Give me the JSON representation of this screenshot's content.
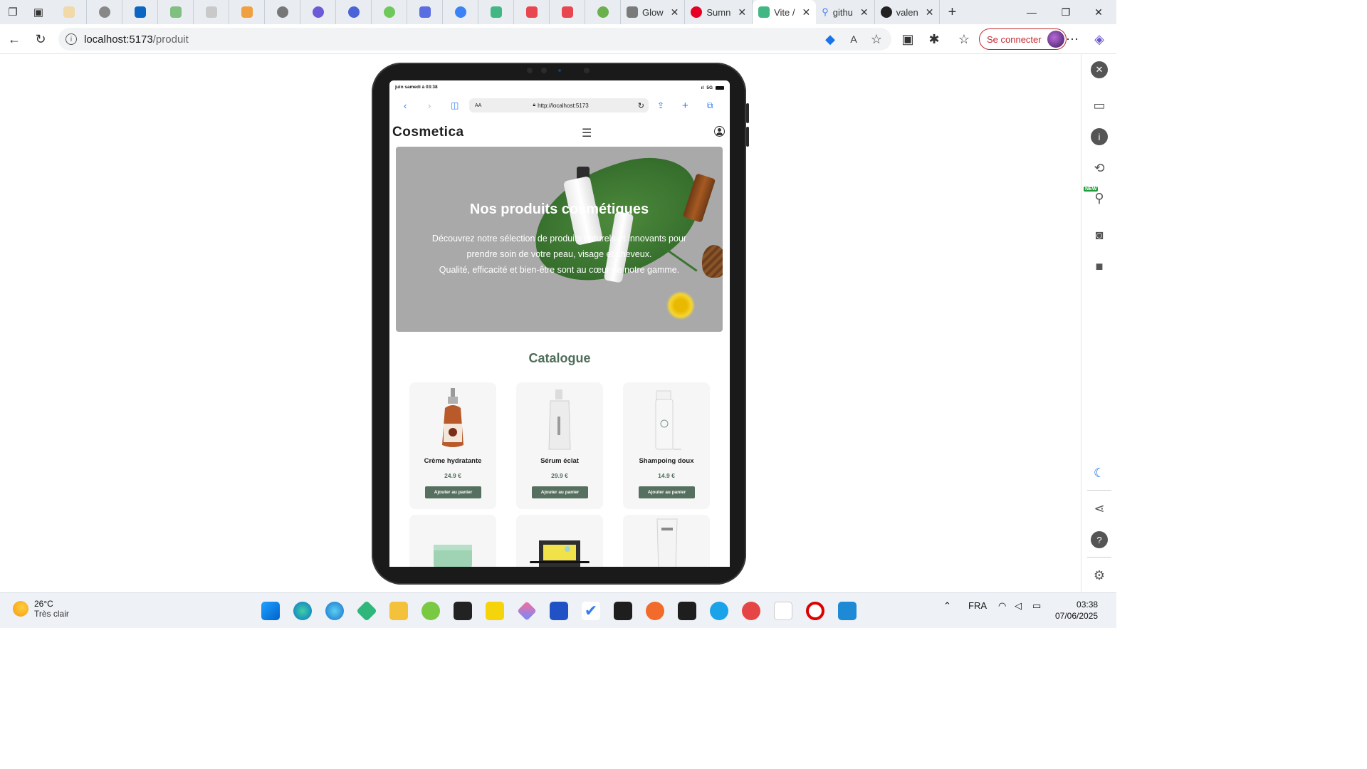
{
  "browser": {
    "tabs": [
      {
        "title": "Glow",
        "color": "#7a7a7a"
      },
      {
        "title": "Sumn",
        "color": "#e60023"
      },
      {
        "title": "Vite /",
        "color": "#41b883",
        "active": true
      },
      {
        "title": "githu",
        "color": "#4f7df0"
      },
      {
        "title": "valen",
        "color": "#222222"
      }
    ],
    "url_host": "localhost:5173",
    "url_path": "/produit",
    "signin_label": "Se connecter"
  },
  "safari": {
    "status_time": "juin samedi à 03:38",
    "status_network": "5G",
    "aa_label": "AA",
    "url": "http://localhost:5173"
  },
  "site": {
    "brand": "Cosmetica",
    "hero": {
      "title": "Nos produits cosmétiques",
      "line1": "Découvrez notre sélection de produits naturels et innovants pour",
      "line2": "prendre soin de votre peau, visage et cheveux.",
      "line3": "Qualité, efficacité et bien-être sont au cœur de notre gamme."
    },
    "catalogue_title": "Catalogue",
    "products": [
      {
        "name": "Crème hydratante",
        "price": "24.9 €",
        "button": "Ajouter au panier"
      },
      {
        "name": "Sérum éclat",
        "price": "29.9 €",
        "button": "Ajouter au panier"
      },
      {
        "name": "Shampoing doux",
        "price": "14.9 €",
        "button": "Ajouter au panier"
      }
    ]
  },
  "taskbar": {
    "temperature": "26°C",
    "weather": "Très clair",
    "language": "FRA",
    "time": "03:38",
    "date": "07/06/2025"
  }
}
